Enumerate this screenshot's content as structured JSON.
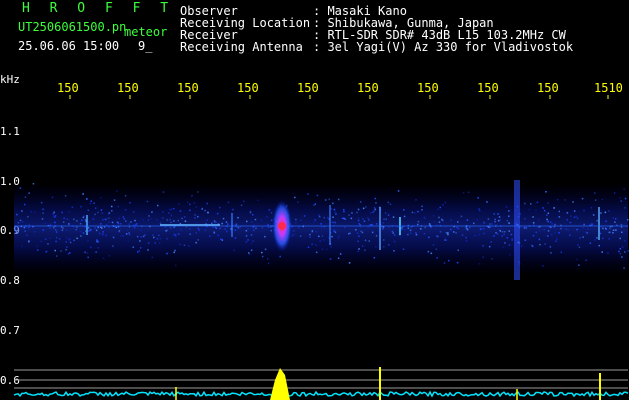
{
  "header": {
    "brand": "H R O F F T",
    "filename": "UT2506061500.pn",
    "kind": "meteor",
    "datetime": "25.06.06 15:00",
    "tail": "9_"
  },
  "meta": [
    {
      "label": "Observer",
      "value": ": Masaki Kano"
    },
    {
      "label": "Receiving Location",
      "value": ": Shibukawa, Gunma, Japan"
    },
    {
      "label": "Receiver",
      "value": ": RTL-SDR SDR# 43dB L15 103.2MHz CW"
    },
    {
      "label": "Receiving Antenna",
      "value": ": 3el Yagi(V) Az 330 for Vladivostok"
    }
  ],
  "axis": {
    "unit": "kHz",
    "freq_ticks": [
      "150",
      "150",
      "150",
      "150",
      "150",
      "150",
      "150",
      "150",
      "150",
      "1510"
    ],
    "y_ticks": [
      "1.1",
      "1.0",
      "0.9",
      "0.8",
      "0.7",
      "0.6"
    ]
  },
  "colors": {
    "header_green": "#3cff3c",
    "ticks": "#ffff00",
    "spectrum": "#00e5ff",
    "peak": "#ffff00"
  }
}
